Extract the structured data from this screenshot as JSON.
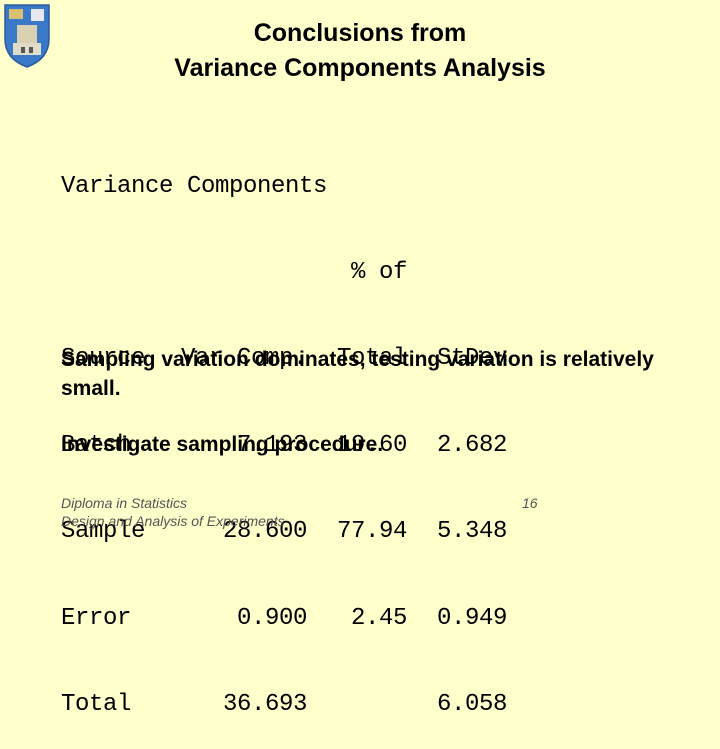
{
  "slide": {
    "title_line1": "Conclusions from",
    "title_line2": "Variance Components Analysis",
    "output_heading": "Variance Components",
    "table": {
      "header_top": [
        "",
        "",
        "% of",
        ""
      ],
      "headers": [
        "Source",
        "Var Comp.",
        "Total",
        "StDev"
      ],
      "rows": [
        [
          "Batch",
          "7.193",
          "19.60",
          "2.682"
        ],
        [
          "Sample",
          "28.600",
          "77.94",
          "5.348"
        ],
        [
          "Error",
          "0.900",
          "2.45",
          "0.949"
        ],
        [
          "Total",
          "36.693",
          "",
          "6.058"
        ]
      ]
    },
    "conclusion1": "Sampling variation dominates, testing variation is relatively small.",
    "conclusion2": "Investigate sampling procedure.",
    "footer_line1": "Diploma in Statistics",
    "footer_line2": "Design and Analysis of Experiments",
    "page_number": "16",
    "logo_icon": "university-crest-icon"
  }
}
